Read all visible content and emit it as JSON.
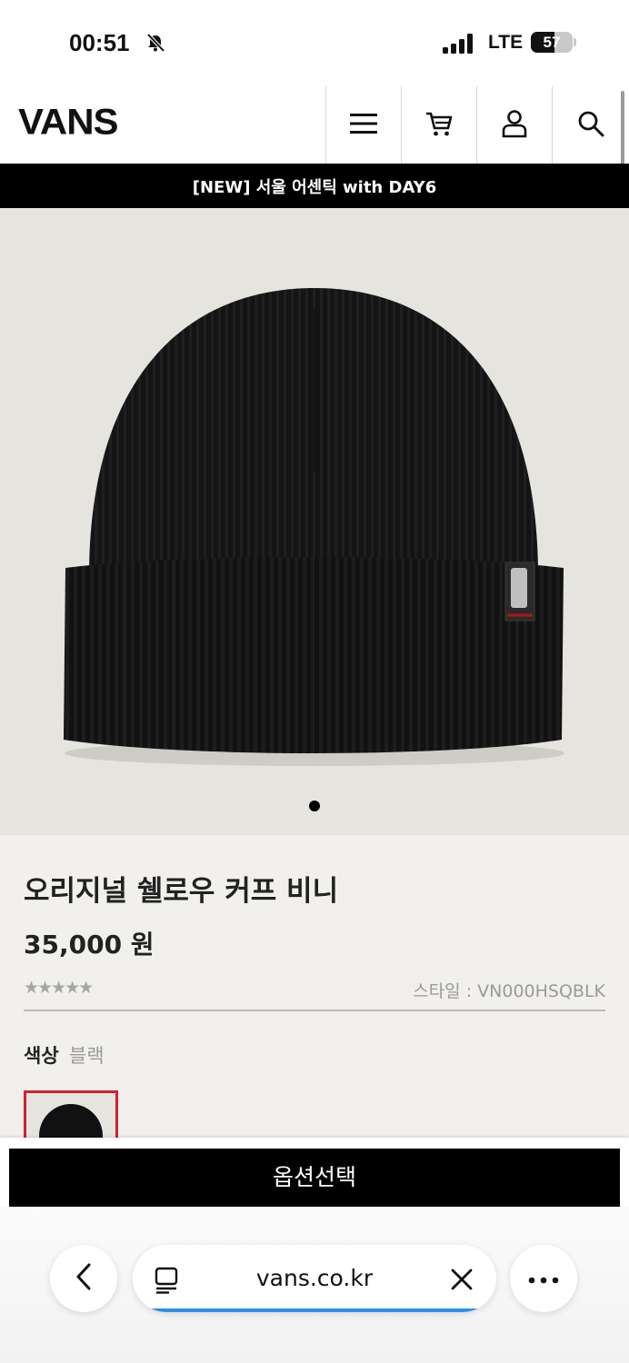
{
  "status_bar": {
    "time": "00:51",
    "network": "LTE",
    "battery": "57",
    "battery_level": 0.57
  },
  "header": {
    "logo": "VANS",
    "icons": [
      "menu-icon",
      "cart-icon",
      "account-icon",
      "search-icon"
    ]
  },
  "promo_banner": {
    "text": "[NEW] 서울 어센틱 with DAY6"
  },
  "product": {
    "name": "오리지널 쉘로우 커프 비니",
    "price": "35,000 원",
    "rating_stars": "★★★★★",
    "rating_value": 0,
    "style_code": "스타일 : VN000HSQBLK",
    "color_label": "색상",
    "color_value": "블랙",
    "image_pages": 1,
    "current_image": 1
  },
  "cta": {
    "option_select": "옵션선택"
  },
  "browser": {
    "url": "vans.co.kr",
    "load_progress": 1.0
  },
  "colors": {
    "accent_red": "#d3202f",
    "progress_blue": "#2a90e8",
    "background": "#f1f0ec"
  }
}
